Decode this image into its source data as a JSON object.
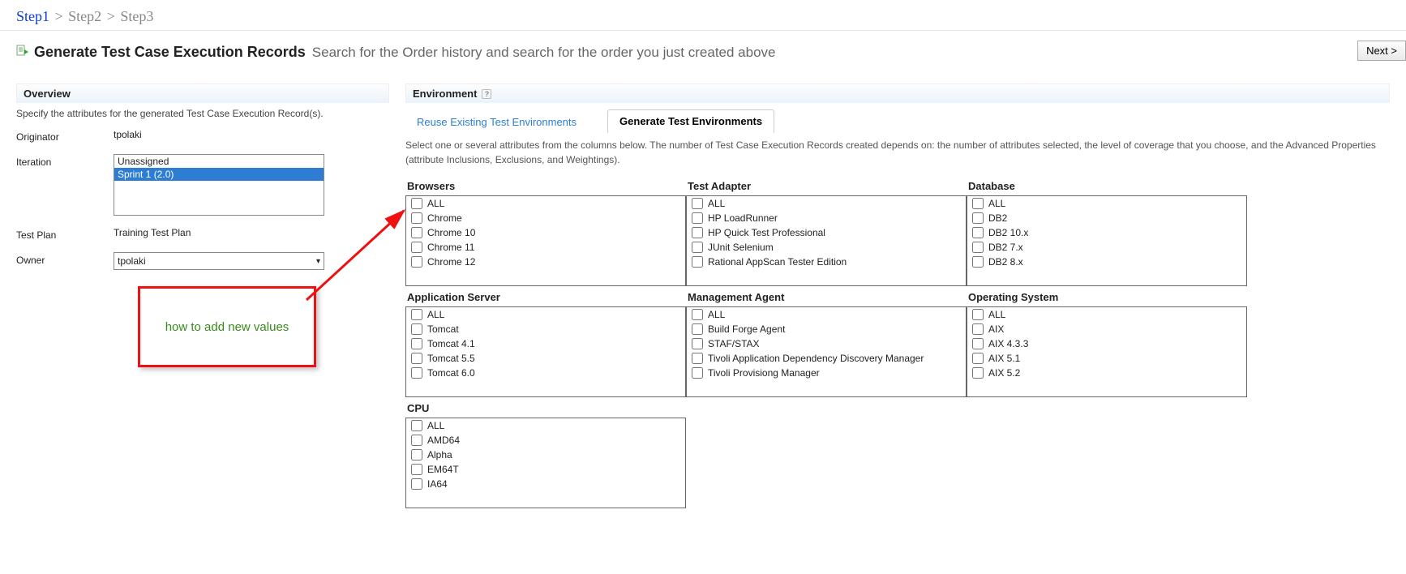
{
  "breadcrumb": {
    "step1": "Step1",
    "step2": "Step2",
    "step3": "Step3"
  },
  "header": {
    "title": "Generate Test Case Execution Records",
    "subtitle": "Search for the Order history and search for the order you just created above",
    "next": "Next >"
  },
  "overview": {
    "section": "Overview",
    "desc": "Specify the attributes for the generated Test Case Execution Record(s).",
    "originator_label": "Originator",
    "originator_value": "tpolaki",
    "iteration_label": "Iteration",
    "iteration_options": [
      "Unassigned",
      "Sprint 1 (2.0)"
    ],
    "testplan_label": "Test Plan",
    "testplan_value": "Training Test Plan",
    "owner_label": "Owner",
    "owner_value": "tpolaki"
  },
  "annotation": "how to add new values",
  "environment": {
    "section": "Environment",
    "tab_reuse": "Reuse Existing Test Environments",
    "tab_generate": "Generate Test Environments",
    "desc": "Select one or several attributes from the columns below. The number of Test Case Execution Records created depends on: the number of attributes selected, the level of coverage that you choose, and the Advanced Properties (attribute Inclusions, Exclusions, and Weightings).",
    "columns": {
      "browsers": {
        "title": "Browsers",
        "items": [
          "ALL",
          "Chrome",
          "Chrome 10",
          "Chrome 11",
          "Chrome 12"
        ]
      },
      "testadapter": {
        "title": "Test Adapter",
        "items": [
          "ALL",
          "HP LoadRunner",
          "HP Quick Test Professional",
          "JUnit Selenium",
          "Rational AppScan Tester Edition"
        ]
      },
      "database": {
        "title": "Database",
        "items": [
          "ALL",
          "DB2",
          "DB2 10.x",
          "DB2 7.x",
          "DB2 8.x"
        ]
      },
      "appserver": {
        "title": "Application Server",
        "items": [
          "ALL",
          "Tomcat",
          "Tomcat 4.1",
          "Tomcat 5.5",
          "Tomcat 6.0"
        ]
      },
      "mgmtagent": {
        "title": "Management Agent",
        "items": [
          "ALL",
          "Build Forge Agent",
          "STAF/STAX",
          "Tivoli Application Dependency Discovery Manager",
          "Tivoli Provisiong Manager"
        ]
      },
      "os": {
        "title": "Operating System",
        "items": [
          "ALL",
          "AIX",
          "AIX 4.3.3",
          "AIX 5.1",
          "AIX 5.2"
        ]
      },
      "cpu": {
        "title": "CPU",
        "items": [
          "ALL",
          "AMD64",
          "Alpha",
          "EM64T",
          "IA64"
        ]
      }
    }
  }
}
